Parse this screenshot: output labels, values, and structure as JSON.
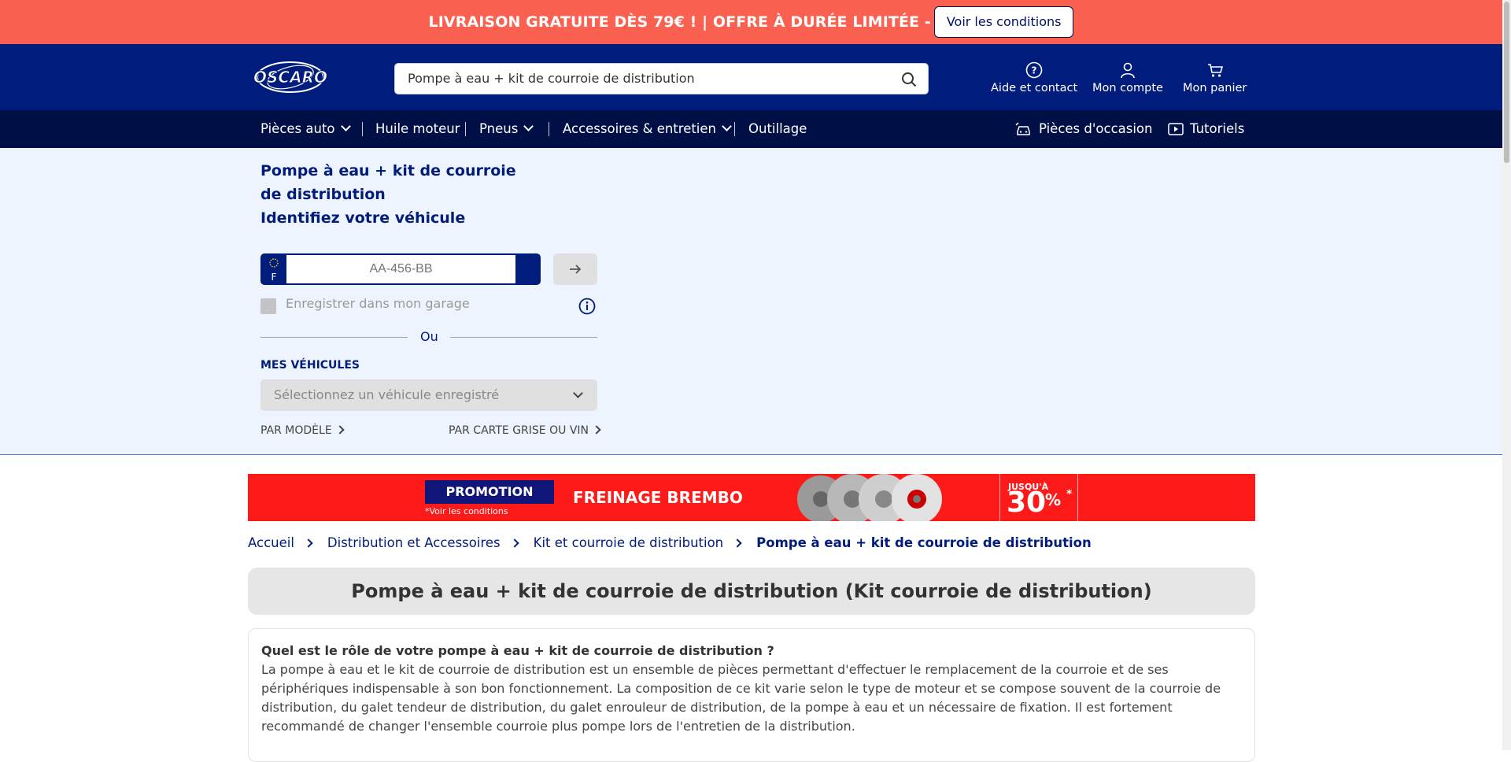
{
  "promo_bar": {
    "text": "LIVRAISON GRATUITE DÈS 79€ ! | OFFRE À DURÉE LIMITÉE -",
    "button_label": "Voir les conditions",
    "color": "#fa6150"
  },
  "header": {
    "logo_text": "OSCARO",
    "search": {
      "value": "Pompe à eau + kit de courroie de distribution",
      "icon": "search-icon"
    },
    "links": [
      {
        "label": "Aide et contact",
        "icon": "help-circle-icon"
      },
      {
        "label": "Mon compte",
        "icon": "user-icon"
      },
      {
        "label": "Mon panier",
        "icon": "cart-icon"
      }
    ],
    "color": "#001c7c"
  },
  "nav": {
    "items": [
      {
        "label": "Pièces auto",
        "has_dropdown": true
      },
      {
        "label": "Huile moteur",
        "has_dropdown": false
      },
      {
        "label": "Pneus",
        "has_dropdown": true
      },
      {
        "label": "Accessoires & entretien",
        "has_dropdown": true
      },
      {
        "label": "Outillage",
        "has_dropdown": false
      }
    ],
    "right_items": [
      {
        "label": "Pièces d'occasion",
        "icon": "car-icon"
      },
      {
        "label": "Tutoriels",
        "icon": "play-icon"
      }
    ]
  },
  "vehicle": {
    "title_line1": "Pompe à eau + kit de courroie",
    "title_line2": "de distribution",
    "title_line3": "Identifiez votre véhicule",
    "plate_country": "F",
    "plate_placeholder": "AA-456-BB",
    "save_label": "Enregistrer dans mon garage",
    "or_label": "Ou",
    "my_vehicles_label": "MES VÉHICULES",
    "select_placeholder": "Sélectionnez un véhicule enregistré",
    "by_model_label": "PAR MODÈLE",
    "by_card_label": "PAR CARTE GRISE OU VIN"
  },
  "banner": {
    "promotion_label": "PROMOTION",
    "note": "*Voir les conditions",
    "title": "FREINAGE BREMBO",
    "upto_label": "JUSQU'À",
    "percent": "30",
    "percent_sign": "%",
    "star": "*"
  },
  "breadcrumb": [
    {
      "label": "Accueil"
    },
    {
      "label": "Distribution et Accessoires"
    },
    {
      "label": "Kit et courroie de distribution"
    },
    {
      "label": "Pompe à eau + kit de courroie de distribution",
      "current": true
    }
  ],
  "page_title": "Pompe à eau + kit de courroie de distribution (Kit courroie de distribution)",
  "description": {
    "question": "Quel est le rôle de votre pompe à eau + kit de courroie de distribution ?",
    "answer": "La pompe à eau et le kit de courroie de distribution est un ensemble de pièces permettant d'effectuer le remplacement de la courroie et de ses périphériques indispensable à son bon fonctionnement. La composition de ce kit varie selon le type de moteur et se compose souvent de la courroie de distribution, du galet tendeur de distribution, du galet enrouleur de distribution, de la pompe à eau et un nécessaire de fixation. Il est fortement recommandé de changer l'ensemble courroie plus pompe lors de l'entretien de la distribution."
  }
}
